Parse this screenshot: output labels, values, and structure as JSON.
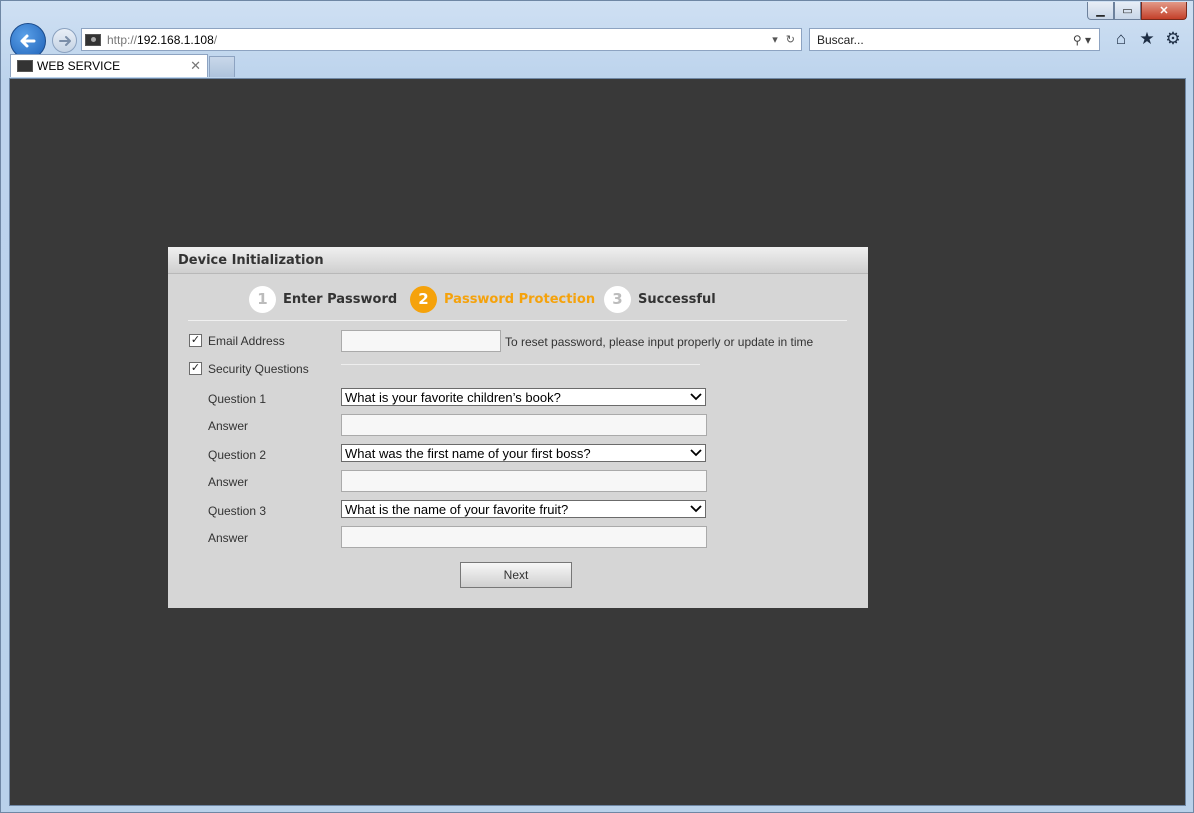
{
  "browser": {
    "url_protocol": "http://",
    "url_host": "192.168.1.108",
    "url_path": "/",
    "search_placeholder": "Buscar...",
    "tab_title": "WEB SERVICE",
    "window_buttons": {
      "minimize": "▁",
      "maximize": "▭",
      "close": "✕"
    },
    "toolbar_icons": [
      "home-icon",
      "star-icon",
      "gear-icon"
    ]
  },
  "dialog": {
    "title": "Device Initialization",
    "steps": [
      {
        "number": "1",
        "label": "Enter Password",
        "active": false
      },
      {
        "number": "2",
        "label": "Password Protection",
        "active": true
      },
      {
        "number": "3",
        "label": "Successful",
        "active": false
      }
    ],
    "email": {
      "checked": true,
      "label": "Email Address",
      "value": "",
      "hint": "To reset password, please input properly or update in time"
    },
    "security": {
      "checked": true,
      "label": "Security Questions",
      "questions": [
        {
          "label": "Question 1",
          "selected": "What is your favorite children’s book?",
          "answer_label": "Answer",
          "answer": ""
        },
        {
          "label": "Question 2",
          "selected": "What was the first name of your first boss?",
          "answer_label": "Answer",
          "answer": ""
        },
        {
          "label": "Question 3",
          "selected": "What is the name of your favorite fruit?",
          "answer_label": "Answer",
          "answer": ""
        }
      ]
    },
    "next_label": "Next"
  },
  "colors": {
    "accent": "#f5a20b",
    "background": "#393939",
    "dialog_bg": "#d6d6d6"
  }
}
